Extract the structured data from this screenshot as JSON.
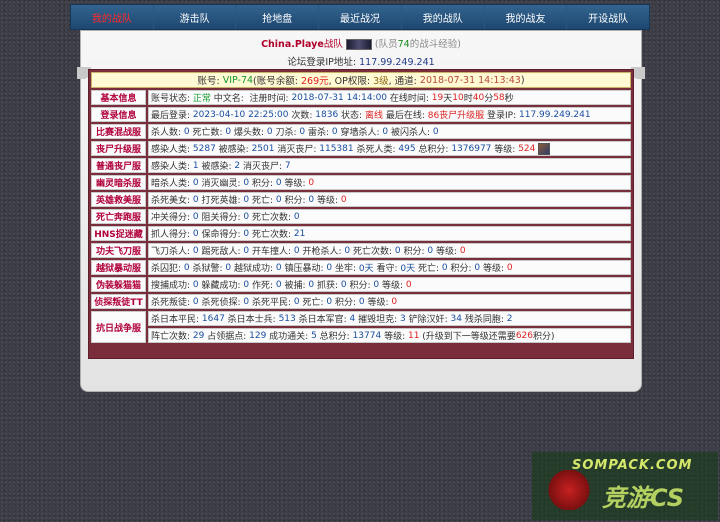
{
  "nav": {
    "items": [
      "我的战队",
      "游击队",
      "抢地盘",
      "最近战况",
      "我的战队",
      "我的战友",
      "开设战队"
    ],
    "active": 0
  },
  "team": {
    "name": "China.Playe",
    "suffix": "战队",
    "members_prefix": "(队员",
    "member_count": "74",
    "members_suffix": "的战斗经验)"
  },
  "forum": {
    "label": "论坛登录IP地址: ",
    "ip": "117.99.249.241"
  },
  "account": {
    "p1": "账号: ",
    "id": "VIP-74",
    "p2": "(账号余额: ",
    "balance": "269元",
    "p3": ", OP权限: ",
    "op": "3级",
    "p4": ", 通道: ",
    "date": "2018-07-31 14:13:43",
    "p5": ")"
  },
  "rows": [
    {
      "label": "基本信息",
      "lines": [
        [
          {
            "t": "账号状态: "
          },
          {
            "t": "正常",
            "c": "g"
          },
          {
            "t": " 中文名:  注册时间: "
          },
          {
            "t": "2018-07-31 14:14:00",
            "c": "n"
          },
          {
            "t": " 在线时间: "
          },
          {
            "t": "19",
            "c": "r"
          },
          {
            "t": "天"
          },
          {
            "t": "10",
            "c": "r"
          },
          {
            "t": "时"
          },
          {
            "t": "40",
            "c": "r"
          },
          {
            "t": "分"
          },
          {
            "t": "58",
            "c": "r"
          },
          {
            "t": "秒"
          }
        ]
      ]
    },
    {
      "label": "登录信息",
      "lines": [
        [
          {
            "t": "最后登录: "
          },
          {
            "t": "2023-04-10 22:25:00",
            "c": "n"
          },
          {
            "t": " 次数: "
          },
          {
            "t": "1836",
            "c": "n"
          },
          {
            "t": " 状态: "
          },
          {
            "t": "离线",
            "c": "r"
          },
          {
            "t": " 最后在线: "
          },
          {
            "t": "86丧尸升级服",
            "c": "r"
          },
          {
            "t": " 登录IP: "
          },
          {
            "t": "117.99.249.241",
            "c": "n"
          }
        ]
      ]
    },
    {
      "label": "比赛混战服",
      "lines": [
        [
          {
            "t": "杀人数: "
          },
          {
            "t": "0",
            "c": "n"
          },
          {
            "t": " 死亡数: "
          },
          {
            "t": "0",
            "c": "n"
          },
          {
            "t": " 爆头数: "
          },
          {
            "t": "0",
            "c": "n"
          },
          {
            "t": " 刀杀: "
          },
          {
            "t": "0",
            "c": "n"
          },
          {
            "t": " 雷杀: "
          },
          {
            "t": "0",
            "c": "n"
          },
          {
            "t": " 穿墙杀人: "
          },
          {
            "t": "0",
            "c": "n"
          },
          {
            "t": " 被闪杀人: "
          },
          {
            "t": "0",
            "c": "n"
          }
        ]
      ]
    },
    {
      "label": "丧尸升级服",
      "avatar": true,
      "lines": [
        [
          {
            "t": "感染人类: "
          },
          {
            "t": "5287",
            "c": "n"
          },
          {
            "t": " 被感染: "
          },
          {
            "t": "2501",
            "c": "n"
          },
          {
            "t": " 消灭丧尸: "
          },
          {
            "t": "115381",
            "c": "n"
          },
          {
            "t": " 杀死人类: "
          },
          {
            "t": "495",
            "c": "n"
          },
          {
            "t": " 总积分: "
          },
          {
            "t": "1376977",
            "c": "n"
          },
          {
            "t": " 等级: "
          },
          {
            "t": "524",
            "c": "r"
          }
        ]
      ]
    },
    {
      "label": "普通丧尸服",
      "lines": [
        [
          {
            "t": "感染人类: "
          },
          {
            "t": "1",
            "c": "n"
          },
          {
            "t": " 被感染: "
          },
          {
            "t": "2",
            "c": "n"
          },
          {
            "t": " 消灭丧尸: "
          },
          {
            "t": "7",
            "c": "n"
          }
        ]
      ]
    },
    {
      "label": "幽灵暗杀服",
      "lines": [
        [
          {
            "t": "暗杀人类: "
          },
          {
            "t": "0",
            "c": "n"
          },
          {
            "t": " 消灭幽灵: "
          },
          {
            "t": "0",
            "c": "n"
          },
          {
            "t": " 积分: "
          },
          {
            "t": "0",
            "c": "n"
          },
          {
            "t": " 等级: "
          },
          {
            "t": "0",
            "c": "r"
          }
        ]
      ]
    },
    {
      "label": "英雄救美服",
      "lines": [
        [
          {
            "t": "杀死美女: "
          },
          {
            "t": "0",
            "c": "n"
          },
          {
            "t": " 打死英雄: "
          },
          {
            "t": "0",
            "c": "n"
          },
          {
            "t": " 死亡: "
          },
          {
            "t": "0",
            "c": "n"
          },
          {
            "t": " 积分: "
          },
          {
            "t": "0",
            "c": "n"
          },
          {
            "t": " 等级: "
          },
          {
            "t": "0",
            "c": "r"
          }
        ]
      ]
    },
    {
      "label": "死亡奔跑服",
      "lines": [
        [
          {
            "t": "冲关得分: "
          },
          {
            "t": "0",
            "c": "n"
          },
          {
            "t": " 阻关得分: "
          },
          {
            "t": "0",
            "c": "n"
          },
          {
            "t": " 死亡次数: "
          },
          {
            "t": "0",
            "c": "n"
          }
        ]
      ]
    },
    {
      "label": "HNS捉迷藏",
      "lines": [
        [
          {
            "t": "抓人得分: "
          },
          {
            "t": "0",
            "c": "n"
          },
          {
            "t": " 保命得分: "
          },
          {
            "t": "0",
            "c": "n"
          },
          {
            "t": " 死亡次数: "
          },
          {
            "t": "21",
            "c": "n"
          }
        ]
      ]
    },
    {
      "label": "功夫飞刀服",
      "lines": [
        [
          {
            "t": "飞刀杀人: "
          },
          {
            "t": "0",
            "c": "n"
          },
          {
            "t": " 踢死敌人: "
          },
          {
            "t": "0",
            "c": "n"
          },
          {
            "t": " 开车撞人: "
          },
          {
            "t": "0",
            "c": "n"
          },
          {
            "t": " 开枪杀人: "
          },
          {
            "t": "0",
            "c": "n"
          },
          {
            "t": " 死亡次数: "
          },
          {
            "t": "0",
            "c": "n"
          },
          {
            "t": " 积分: "
          },
          {
            "t": "0",
            "c": "n"
          },
          {
            "t": " 等级: "
          },
          {
            "t": "0",
            "c": "r"
          }
        ]
      ]
    },
    {
      "label": "越狱暴动服",
      "lines": [
        [
          {
            "t": "杀囚犯: "
          },
          {
            "t": "0",
            "c": "n"
          },
          {
            "t": " 杀狱警: "
          },
          {
            "t": "0",
            "c": "n"
          },
          {
            "t": " 越狱成功: "
          },
          {
            "t": "0",
            "c": "n"
          },
          {
            "t": " 镇压暴动: "
          },
          {
            "t": "0",
            "c": "n"
          },
          {
            "t": " 坐牢: "
          },
          {
            "t": "0天",
            "c": "n"
          },
          {
            "t": " 看守: "
          },
          {
            "t": "0天",
            "c": "n"
          },
          {
            "t": " 死亡: "
          },
          {
            "t": "0",
            "c": "n"
          },
          {
            "t": " 积分: "
          },
          {
            "t": "0",
            "c": "n"
          },
          {
            "t": " 等级: "
          },
          {
            "t": "0",
            "c": "r"
          }
        ]
      ]
    },
    {
      "label": "伪装躲猫猫",
      "lines": [
        [
          {
            "t": "搜捕成功: "
          },
          {
            "t": "0",
            "c": "n"
          },
          {
            "t": " 躲藏成功: "
          },
          {
            "t": "0",
            "c": "n"
          },
          {
            "t": " 作死: "
          },
          {
            "t": "0",
            "c": "n"
          },
          {
            "t": " 被捕: "
          },
          {
            "t": "0",
            "c": "n"
          },
          {
            "t": " 抓获: "
          },
          {
            "t": "0",
            "c": "n"
          },
          {
            "t": " 积分: "
          },
          {
            "t": "0",
            "c": "n"
          },
          {
            "t": " 等级: "
          },
          {
            "t": "0",
            "c": "r"
          }
        ]
      ]
    },
    {
      "label": "侦探叛徒TT",
      "lines": [
        [
          {
            "t": "杀死叛徒: "
          },
          {
            "t": "0",
            "c": "n"
          },
          {
            "t": " 杀死侦探: "
          },
          {
            "t": "0",
            "c": "n"
          },
          {
            "t": " 杀死平民: "
          },
          {
            "t": "0",
            "c": "n"
          },
          {
            "t": " 死亡: "
          },
          {
            "t": "0",
            "c": "n"
          },
          {
            "t": " 积分: "
          },
          {
            "t": "0",
            "c": "n"
          },
          {
            "t": " 等级: "
          },
          {
            "t": "0",
            "c": "r"
          }
        ]
      ]
    },
    {
      "label": "抗日战争服",
      "lines": [
        [
          {
            "t": "杀日本平民: "
          },
          {
            "t": "1647",
            "c": "n"
          },
          {
            "t": " 杀日本士兵: "
          },
          {
            "t": "513",
            "c": "n"
          },
          {
            "t": " 杀日本军官: "
          },
          {
            "t": "4",
            "c": "n"
          },
          {
            "t": " 摧毁坦克: "
          },
          {
            "t": "3",
            "c": "n"
          },
          {
            "t": " 铲除汉奸: "
          },
          {
            "t": "34",
            "c": "n"
          },
          {
            "t": " 残杀同胞: "
          },
          {
            "t": "2",
            "c": "n"
          }
        ],
        [
          {
            "t": "阵亡次数: "
          },
          {
            "t": "29",
            "c": "n"
          },
          {
            "t": " 占领据点: "
          },
          {
            "t": "129",
            "c": "n"
          },
          {
            "t": " 成功通关: "
          },
          {
            "t": "5",
            "c": "n"
          },
          {
            "t": " 总积分: "
          },
          {
            "t": "13774",
            "c": "n"
          },
          {
            "t": " 等级: "
          },
          {
            "t": "11",
            "c": "r"
          },
          {
            "t": " (升级到下一等级还需要"
          },
          {
            "t": "626",
            "c": "r"
          },
          {
            "t": "积分)"
          }
        ]
      ]
    }
  ],
  "watermark": {
    "top": "SOMPACK.COM",
    "bottom": "竞游CS"
  }
}
